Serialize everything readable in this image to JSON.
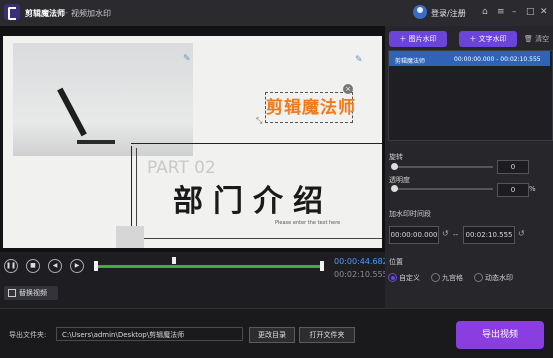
{
  "app": {
    "name": "剪辑魔法师",
    "separator": "-",
    "page_title": "视频加水印"
  },
  "titlebar": {
    "login": "登录/注册",
    "icons": [
      "avatar-icon",
      "home-icon",
      "menu-icon",
      "minimize-icon",
      "maximize-icon",
      "close-icon"
    ]
  },
  "preview": {
    "slide_part": "PART 02",
    "slide_heading": "部门介绍",
    "slide_sub": "Please enter the text here",
    "watermark_text": "剪辑魔法师",
    "watermark_close": "×"
  },
  "player": {
    "current_time": "00:00:44.682",
    "total_time": "00:02:10.555",
    "progress_fraction": 1.0,
    "replace_button": "替换视频"
  },
  "watermark_panel": {
    "add_image": "图片水印",
    "add_text": "文字水印",
    "clear": "清空",
    "rows": [
      {
        "name": "剪辑魔法师",
        "range": "00:00:00.000 - 00:02:10.555"
      }
    ]
  },
  "properties": {
    "rotation_label": "旋转",
    "rotation_value": "0",
    "opacity_label": "透明度",
    "opacity_value": "0",
    "opacity_unit": "%",
    "time_label": "加水印时间段",
    "time_start": "00:00:00.000",
    "time_dash": "--",
    "time_end": "00:02:10.555",
    "position_label": "位置",
    "positions": [
      "自定义",
      "九宫格",
      "动态水印"
    ],
    "selected_position": "自定义"
  },
  "footer": {
    "output_label": "导出文件夹:",
    "output_path": "C:\\Users\\admin\\Desktop\\剪辑魔法师",
    "change_dir": "更改目录",
    "open_folder": "打开文件夹",
    "export": "导出视频"
  },
  "colors": {
    "accent": "#6b44d9",
    "export": "#8a3ee0",
    "progress": "#3fae3f",
    "time_current": "#4a9eff",
    "watermark": "#f07a1e"
  }
}
